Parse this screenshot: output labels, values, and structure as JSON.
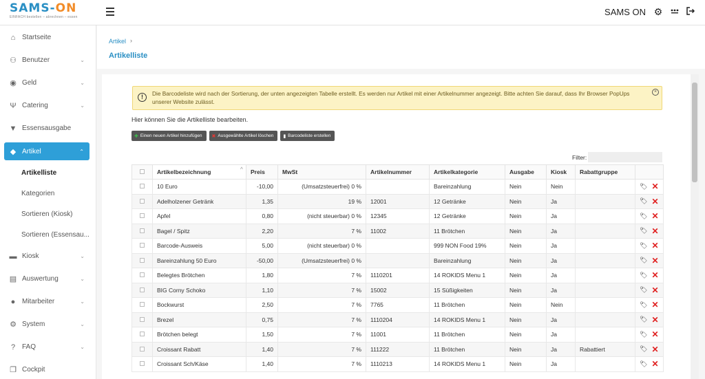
{
  "app": {
    "logo_text_main": "SAMS-",
    "logo_text_on": "ON",
    "logo_tagline": "EINFACH bestellen – abrechnen – essen",
    "user_name": "SAMS ON",
    "icons": {
      "settings": "gear-icon",
      "apps": "dots-icon",
      "logout": "logout-icon",
      "menu": "hamburger-icon"
    }
  },
  "sidebar": {
    "items": [
      {
        "label": "Startseite",
        "icon": "home-icon",
        "glyph": "⌂",
        "expandable": false
      },
      {
        "label": "Benutzer",
        "icon": "users-icon",
        "glyph": "👥",
        "expandable": true
      },
      {
        "label": "Geld",
        "icon": "piggybank-icon",
        "glyph": "🐷",
        "expandable": true
      },
      {
        "label": "Catering",
        "icon": "cutlery-icon",
        "glyph": "🍴",
        "expandable": true
      },
      {
        "label": "Essensausgabe",
        "icon": "shield-icon",
        "glyph": "⛉",
        "expandable": false
      },
      {
        "label": "Artikel",
        "icon": "tag-icon",
        "glyph": "🏷",
        "expandable": true,
        "active": true
      }
    ],
    "sub_items": [
      {
        "label": "Artikelliste",
        "current": true
      },
      {
        "label": "Kategorien"
      },
      {
        "label": "Sortieren (Kiosk)"
      },
      {
        "label": "Sortieren (Essensau..."
      }
    ],
    "items_after": [
      {
        "label": "Kiosk",
        "icon": "kiosk-icon",
        "glyph": "▬",
        "expandable": true
      },
      {
        "label": "Auswertung",
        "icon": "clipboard-icon",
        "glyph": "📋",
        "expandable": true
      },
      {
        "label": "Mitarbeiter",
        "icon": "person-icon",
        "glyph": "👤",
        "expandable": true
      },
      {
        "label": "System",
        "icon": "gear-icon",
        "glyph": "⚙",
        "expandable": true
      },
      {
        "label": "FAQ",
        "icon": "question-icon",
        "glyph": "?",
        "expandable": true
      },
      {
        "label": "Cockpit",
        "icon": "copy-icon",
        "glyph": "❐",
        "expandable": false
      }
    ]
  },
  "breadcrumb": {
    "label": "Artikel",
    "separator": "›"
  },
  "page": {
    "title": "Artikelliste"
  },
  "alert": {
    "text": "Die Barcodeliste wird nach der Sortierung, der unten angezeigten Tabelle erstellt. Es werden nur Artikel mit einer Artikelnummer angezeigt. Bitte achten Sie darauf, dass Ihr Browser PopUps unserer Website zulässt."
  },
  "intro": "Hier können Sie die Artikelliste bearbeiten.",
  "buttons": {
    "add": "Einen neuen Artikel hinzufügen",
    "delete_selected": "Ausgewählte Artikel löschen",
    "barcode": "Barcodeliste erstellen"
  },
  "filter": {
    "label": "Filter:",
    "value": ""
  },
  "table": {
    "headers": [
      "Artikelbezeichnung",
      "Preis",
      "MwSt",
      "Artikelnummer",
      "Artikelkategorie",
      "Ausgabe",
      "Kiosk",
      "Rabattgruppe"
    ],
    "rows": [
      [
        "10 Euro",
        "-10,00",
        "(Umsatzsteuerfrei) 0 %",
        "",
        "Bareinzahlung",
        "Nein",
        "Nein",
        ""
      ],
      [
        "Adelholzener Getränk",
        "1,35",
        "19 %",
        "12001",
        "12 Getränke",
        "Nein",
        "Ja",
        ""
      ],
      [
        "Apfel",
        "0,80",
        "(nicht steuerbar) 0 %",
        "12345",
        "12 Getränke",
        "Nein",
        "Ja",
        ""
      ],
      [
        "Bagel / Spitz",
        "2,20",
        "7 %",
        "11002",
        "11 Brötchen",
        "Nein",
        "Ja",
        ""
      ],
      [
        "Barcode-Ausweis",
        "5,00",
        "(nicht steuerbar) 0 %",
        "",
        "999 NON Food 19%",
        "Nein",
        "Ja",
        ""
      ],
      [
        "Bareinzahlung 50 Euro",
        "-50,00",
        "(Umsatzsteuerfrei) 0 %",
        "",
        "Bareinzahlung",
        "Nein",
        "Ja",
        ""
      ],
      [
        "Belegtes Brötchen",
        "1,80",
        "7 %",
        "1110201",
        "14 ROKIDS Menu 1",
        "Nein",
        "Ja",
        ""
      ],
      [
        "BIG Corny Schoko",
        "1,10",
        "7 %",
        "15002",
        "15 Süßigkeiten",
        "Nein",
        "Ja",
        ""
      ],
      [
        "Bockwurst",
        "2,50",
        "7 %",
        "7765",
        "11 Brötchen",
        "Nein",
        "Nein",
        ""
      ],
      [
        "Brezel",
        "0,75",
        "7 %",
        "1110204",
        "14 ROKIDS Menu 1",
        "Nein",
        "Ja",
        ""
      ],
      [
        "Brötchen belegt",
        "1,50",
        "7 %",
        "11001",
        "11 Brötchen",
        "Nein",
        "Ja",
        ""
      ],
      [
        "Croissant Rabatt",
        "1,40",
        "7 %",
        "111222",
        "11 Brötchen",
        "Nein",
        "Ja",
        "Rabattiert"
      ],
      [
        "Croissant Sch/Käse",
        "1,40",
        "7 %",
        "1110213",
        "14 ROKIDS Menu 1",
        "Nein",
        "Ja",
        ""
      ]
    ]
  }
}
